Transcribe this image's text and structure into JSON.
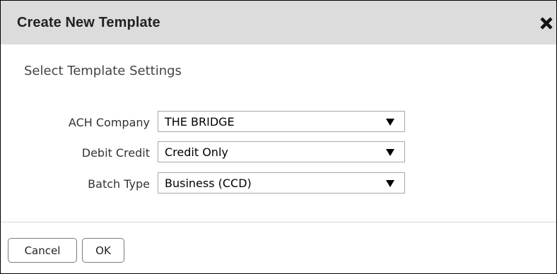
{
  "dialog": {
    "title": "Create New Template",
    "subtitle": "Select Template Settings",
    "fields": [
      {
        "label": "ACH Company",
        "value": "THE BRIDGE"
      },
      {
        "label": "Debit Credit",
        "value": "Credit Only"
      },
      {
        "label": "Batch Type",
        "value": "Business (CCD)"
      }
    ],
    "buttons": {
      "cancel": "Cancel",
      "ok": "OK"
    }
  },
  "icons": {
    "close": "close-icon",
    "dropdown": "triangle-down-icon"
  },
  "colors": {
    "titlebar_bg": "#dcdcdc",
    "border": "#000000"
  }
}
